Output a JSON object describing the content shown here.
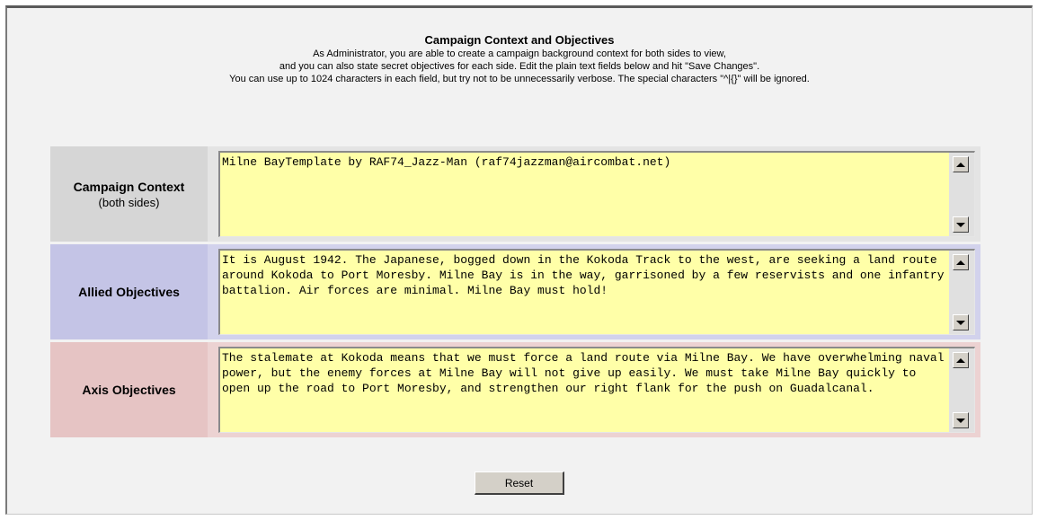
{
  "header": {
    "title": "Campaign Context and Objectives",
    "description_lines": [
      "As Administrator, you are able to create a campaign background context for both sides to view,",
      "and you can also state secret objectives for each side. Edit the plain text fields below and hit \"Save Changes\".",
      "You can use up to 1024 characters in each field, but try not to be unnecessarily verbose. The special characters \"^|{}\" will be ignored."
    ]
  },
  "fields": {
    "context": {
      "label": "Campaign Context",
      "sublabel": "(both sides)",
      "value": "Milne BayTemplate by RAF74_Jazz-Man (raf74jazzman@aircombat.net)"
    },
    "allied": {
      "label": "Allied Objectives",
      "value": "It is August 1942. The Japanese, bogged down in the Kokoda Track to the west, are seeking a land route around Kokoda to Port Moresby. Milne Bay is in the way, garrisoned by a few reservists and one infantry battalion. Air forces are minimal. Milne Bay must hold!"
    },
    "axis": {
      "label": "Axis Objectives",
      "value": "The stalemate at Kokoda means that we must force a land route via Milne Bay. We have overwhelming naval power, but the enemy forces at Milne Bay will not give up easily. We must take Milne Bay quickly to open up the road to Port Moresby, and strengthen our right flank for the push on Guadalcanal."
    }
  },
  "buttons": {
    "reset_label": "Reset"
  },
  "colors": {
    "textarea_bg": "#ffffa8",
    "context_label_bg": "#d6d6d6",
    "allied_label_bg": "#c4c4e6",
    "axis_label_bg": "#e6c4c4"
  },
  "icons": {
    "scroll_up": "triangle-up",
    "scroll_down": "triangle-down"
  }
}
